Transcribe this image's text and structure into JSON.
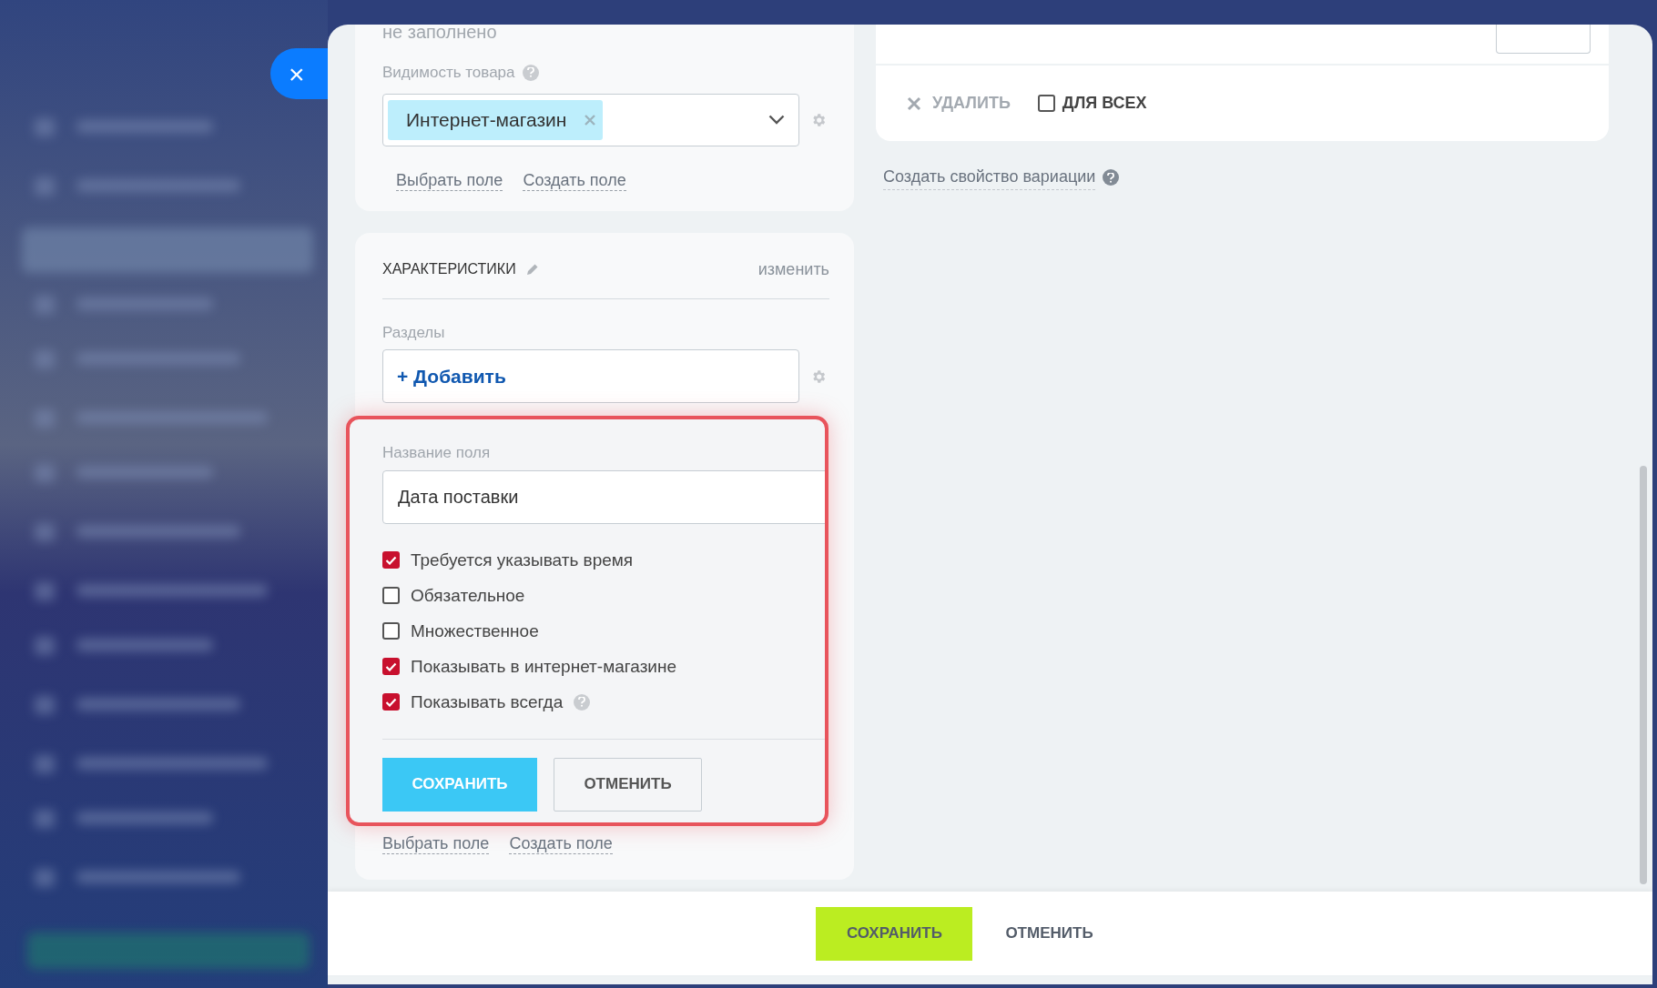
{
  "close_button": {
    "label": "×"
  },
  "visibility_card": {
    "cut_text": "не заполнено",
    "label": "Видимость товара",
    "tags": [
      {
        "label": "Интернет-магазин"
      }
    ],
    "links": [
      "Выбрать поле",
      "Создать поле"
    ]
  },
  "characteristics_card": {
    "title": "ХАРАКТЕРИСТИКИ",
    "edit_link": "изменить",
    "sections_label": "Разделы",
    "add_button": "+ Добавить",
    "new_field": {
      "label": "Название поля",
      "value": "Дата поставки",
      "options": [
        {
          "label": "Требуется указывать время",
          "checked": true,
          "help": false
        },
        {
          "label": "Обязательное",
          "checked": false,
          "help": false
        },
        {
          "label": "Множественное",
          "checked": false,
          "help": false
        },
        {
          "label": "Показывать в интернет-магазине",
          "checked": true,
          "help": false
        },
        {
          "label": "Показывать всегда",
          "checked": true,
          "help": true
        }
      ],
      "save": "СОХРАНИТЬ",
      "cancel": "ОТМЕНИТЬ"
    },
    "links": [
      "Выбрать поле",
      "Создать поле"
    ]
  },
  "variations_card": {
    "delete": "УДАЛИТЬ",
    "for_all": {
      "label": "ДЛЯ ВСЕХ",
      "checked": false
    }
  },
  "create_variation_link": "Создать свойство вариации",
  "footer": {
    "save": "СОХРАНИТЬ",
    "cancel": "ОТМЕНИТЬ"
  }
}
